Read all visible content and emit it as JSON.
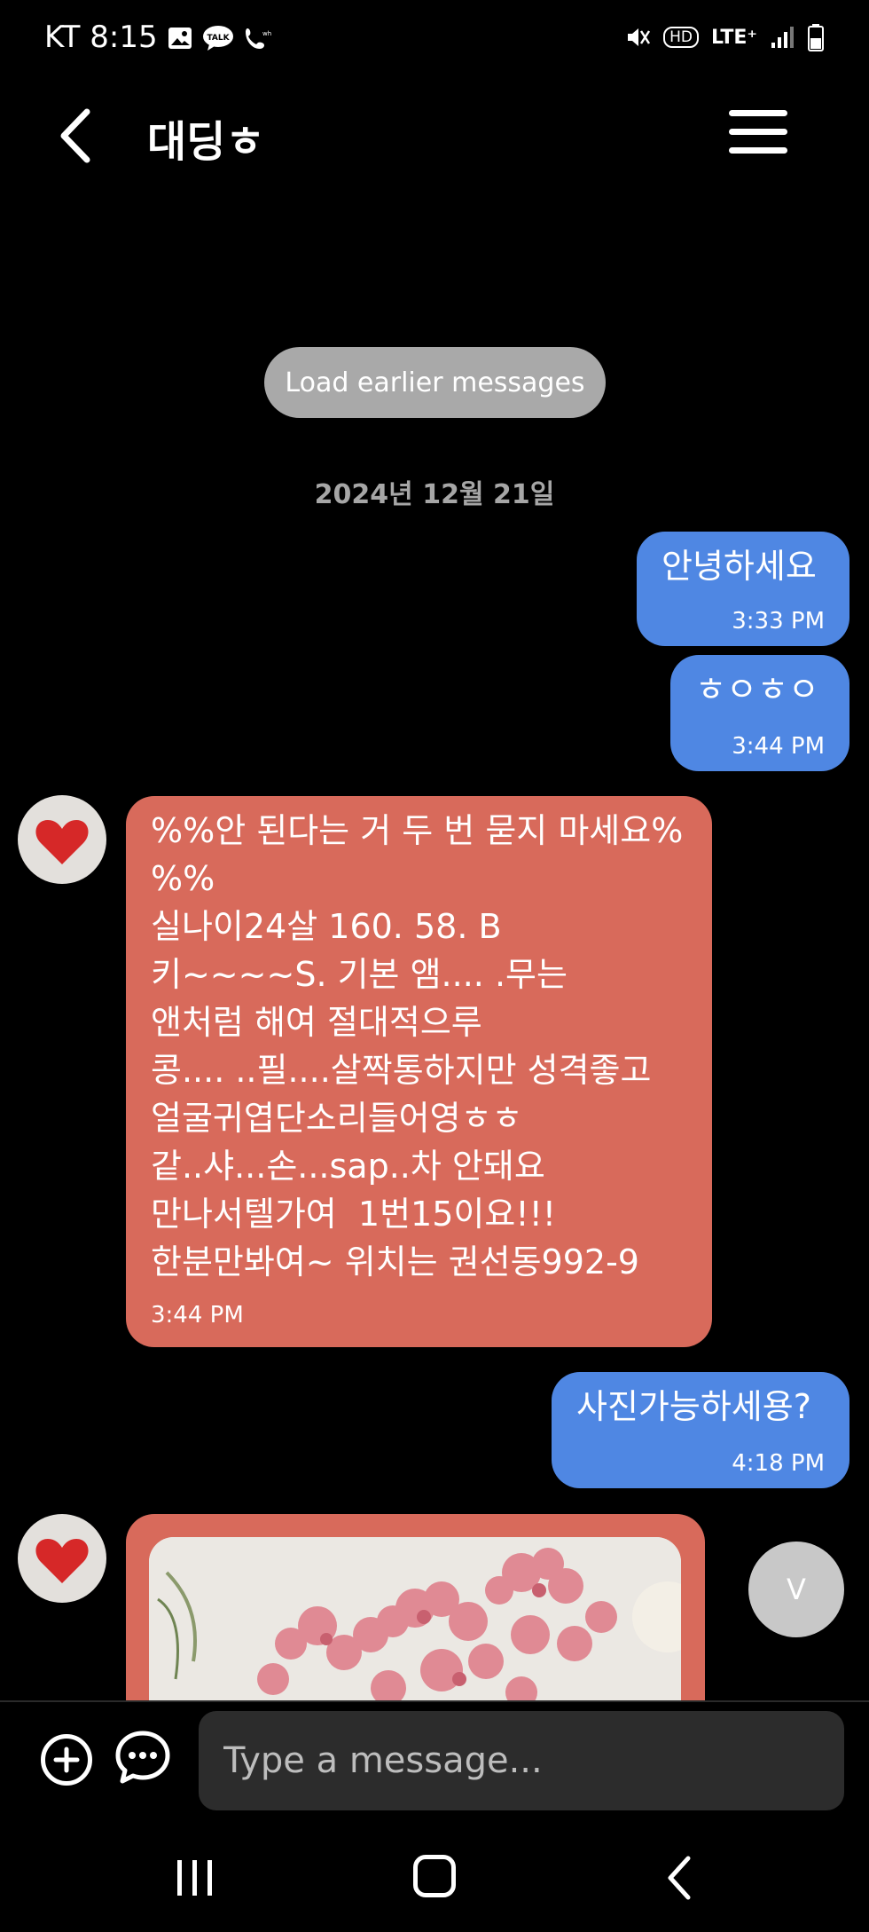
{
  "status_bar": {
    "carrier_time": "KT 8:15",
    "lte": "LTE⁺",
    "hd": "HD"
  },
  "header": {
    "title": "대딩ㅎ"
  },
  "load_earlier": "Load earlier messages",
  "date_divider": "2024년 12월 21일",
  "messages": [
    {
      "dir": "out",
      "text": "안녕하세요",
      "time": "3:33 PM"
    },
    {
      "dir": "out",
      "text": "ㅎㅇㅎㅇ",
      "time": "3:44 PM"
    },
    {
      "dir": "in",
      "text": "%%안 된다는 거 두 번 묻지 마세요%\n%%\n실나이24살 160. 58. B\n키~~~~S. 기본 앰.... .무는\n앤처럼 해여 절대적으루\n콩.... ..필....살짝통하지만 성격좋고\n얼굴귀엽단소리들어영ㅎㅎ\n같..샤...손...sap..차 안돼요\n만나서텔가여  1번15이요!!!\n한분만봐여~ 위치는 권선동992-9",
      "time": "3:44 PM"
    },
    {
      "dir": "out",
      "text": "사진가능하세용?",
      "time": "4:18 PM"
    }
  ],
  "scroll_button": "V",
  "composer": {
    "placeholder": "Type a message..."
  },
  "colors": {
    "outgoing": "#4f87e3",
    "incoming": "#d86a5b",
    "background": "#000000"
  },
  "icons": [
    "back-icon",
    "menu-icon",
    "plus-icon",
    "chat-bubble-icon",
    "recent-apps-icon",
    "home-icon",
    "nav-back-icon"
  ]
}
